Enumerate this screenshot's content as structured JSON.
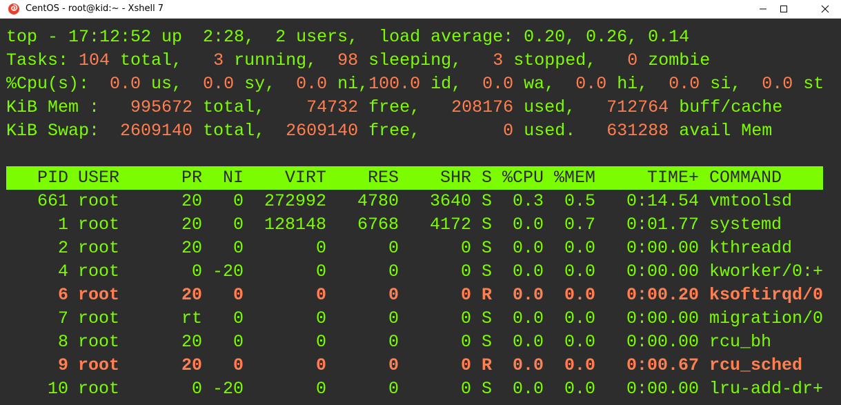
{
  "window": {
    "title": "CentOS - root@kid:~ - Xshell 7",
    "minimize_glyph": "—",
    "maximize_glyph": "☐",
    "close_glyph": "✕"
  },
  "colors": {
    "background": "#2d2d2d",
    "text_green": "#7cfc00",
    "value_orange": "#ff7f50",
    "header_bg": "#7cfc00"
  },
  "summary": [
    [
      {
        "t": "top - 17:12:52 up  2:28,  2 users,  load average: 0.20, 0.26, 0.14",
        "c": "g"
      }
    ],
    [
      {
        "t": "Tasks: ",
        "c": "g"
      },
      {
        "t": "104",
        "c": "o"
      },
      {
        "t": " total,   ",
        "c": "g"
      },
      {
        "t": "3",
        "c": "o"
      },
      {
        "t": " running,  ",
        "c": "g"
      },
      {
        "t": "98",
        "c": "o"
      },
      {
        "t": " sleeping,   ",
        "c": "g"
      },
      {
        "t": "3",
        "c": "o"
      },
      {
        "t": " stopped,   ",
        "c": "g"
      },
      {
        "t": "0",
        "c": "o"
      },
      {
        "t": " zombie",
        "c": "g"
      }
    ],
    [
      {
        "t": "%Cpu(s):  ",
        "c": "g"
      },
      {
        "t": "0.0",
        "c": "o"
      },
      {
        "t": " us,  ",
        "c": "g"
      },
      {
        "t": "0.0",
        "c": "o"
      },
      {
        "t": " sy,  ",
        "c": "g"
      },
      {
        "t": "0.0",
        "c": "o"
      },
      {
        "t": " ni,",
        "c": "g"
      },
      {
        "t": "100.0",
        "c": "o"
      },
      {
        "t": " id,  ",
        "c": "g"
      },
      {
        "t": "0.0",
        "c": "o"
      },
      {
        "t": " wa,  ",
        "c": "g"
      },
      {
        "t": "0.0",
        "c": "o"
      },
      {
        "t": " hi,  ",
        "c": "g"
      },
      {
        "t": "0.0",
        "c": "o"
      },
      {
        "t": " si,  ",
        "c": "g"
      },
      {
        "t": "0.0",
        "c": "o"
      },
      {
        "t": " st",
        "c": "g"
      }
    ],
    [
      {
        "t": "KiB Mem :   ",
        "c": "g"
      },
      {
        "t": "995672",
        "c": "o"
      },
      {
        "t": " total,    ",
        "c": "g"
      },
      {
        "t": "74732",
        "c": "o"
      },
      {
        "t": " free,   ",
        "c": "g"
      },
      {
        "t": "208176",
        "c": "o"
      },
      {
        "t": " used,   ",
        "c": "g"
      },
      {
        "t": "712764",
        "c": "o"
      },
      {
        "t": " buff/cache",
        "c": "g"
      }
    ],
    [
      {
        "t": "KiB Swap:  ",
        "c": "g"
      },
      {
        "t": "2609140",
        "c": "o"
      },
      {
        "t": " total,  ",
        "c": "g"
      },
      {
        "t": "2609140",
        "c": "o"
      },
      {
        "t": " free,        ",
        "c": "g"
      },
      {
        "t": "0",
        "c": "o"
      },
      {
        "t": " used.   ",
        "c": "g"
      },
      {
        "t": "631288",
        "c": "o"
      },
      {
        "t": " avail Mem",
        "c": "g"
      }
    ]
  ],
  "process_table": {
    "columns": [
      "PID",
      "USER",
      "PR",
      "NI",
      "VIRT",
      "RES",
      "SHR",
      "S",
      "%CPU",
      "%MEM",
      "TIME+",
      "COMMAND"
    ],
    "rows": [
      {
        "pid": "661",
        "user": "root",
        "pr": "20",
        "ni": "0",
        "virt": "272992",
        "res": "4780",
        "shr": "3640",
        "s": "S",
        "cpu": "0.3",
        "mem": "0.5",
        "time": "0:14.54",
        "command": "vmtoolsd",
        "running": false
      },
      {
        "pid": "1",
        "user": "root",
        "pr": "20",
        "ni": "0",
        "virt": "128148",
        "res": "6768",
        "shr": "4172",
        "s": "S",
        "cpu": "0.0",
        "mem": "0.7",
        "time": "0:01.77",
        "command": "systemd",
        "running": false
      },
      {
        "pid": "2",
        "user": "root",
        "pr": "20",
        "ni": "0",
        "virt": "0",
        "res": "0",
        "shr": "0",
        "s": "S",
        "cpu": "0.0",
        "mem": "0.0",
        "time": "0:00.00",
        "command": "kthreadd",
        "running": false
      },
      {
        "pid": "4",
        "user": "root",
        "pr": "0",
        "ni": "-20",
        "virt": "0",
        "res": "0",
        "shr": "0",
        "s": "S",
        "cpu": "0.0",
        "mem": "0.0",
        "time": "0:00.00",
        "command": "kworker/0:+",
        "running": false
      },
      {
        "pid": "6",
        "user": "root",
        "pr": "20",
        "ni": "0",
        "virt": "0",
        "res": "0",
        "shr": "0",
        "s": "R",
        "cpu": "0.0",
        "mem": "0.0",
        "time": "0:00.20",
        "command": "ksoftirqd/0",
        "running": true
      },
      {
        "pid": "7",
        "user": "root",
        "pr": "rt",
        "ni": "0",
        "virt": "0",
        "res": "0",
        "shr": "0",
        "s": "S",
        "cpu": "0.0",
        "mem": "0.0",
        "time": "0:00.00",
        "command": "migration/0",
        "running": false
      },
      {
        "pid": "8",
        "user": "root",
        "pr": "20",
        "ni": "0",
        "virt": "0",
        "res": "0",
        "shr": "0",
        "s": "S",
        "cpu": "0.0",
        "mem": "0.0",
        "time": "0:00.00",
        "command": "rcu_bh",
        "running": false
      },
      {
        "pid": "9",
        "user": "root",
        "pr": "20",
        "ni": "0",
        "virt": "0",
        "res": "0",
        "shr": "0",
        "s": "R",
        "cpu": "0.0",
        "mem": "0.0",
        "time": "0:00.67",
        "command": "rcu_sched",
        "running": true
      },
      {
        "pid": "10",
        "user": "root",
        "pr": "0",
        "ni": "-20",
        "virt": "0",
        "res": "0",
        "shr": "0",
        "s": "S",
        "cpu": "0.0",
        "mem": "0.0",
        "time": "0:00.00",
        "command": "lru-add-dr+",
        "running": false
      }
    ]
  }
}
